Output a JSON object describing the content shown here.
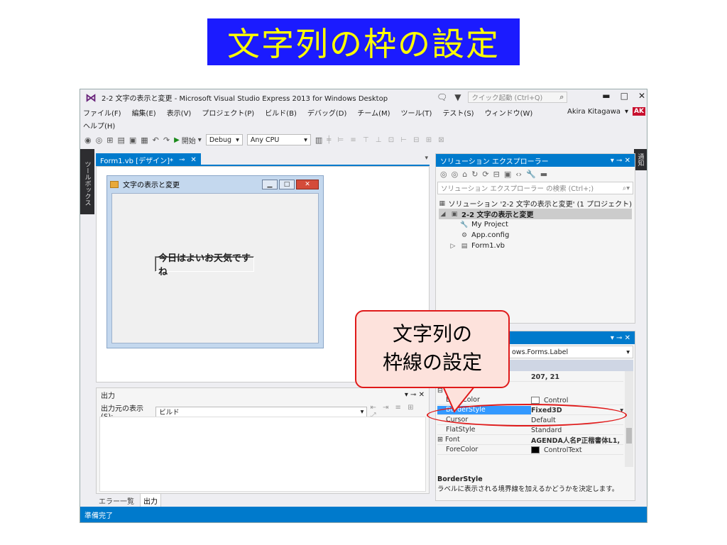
{
  "slide_title": "文字列の枠の設定",
  "window": {
    "title": "2-2 文字の表示と変更 - Microsoft Visual Studio Express 2013 for Windows Desktop",
    "quick_launch_placeholder": "クイック起動 (Ctrl+Q)",
    "user_name": "Akira Kitagawa",
    "avatar_initials": "AK"
  },
  "menu": {
    "row1": [
      "ファイル(F)",
      "編集(E)",
      "表示(V)",
      "プロジェクト(P)",
      "ビルド(B)",
      "デバッグ(D)",
      "チーム(M)",
      "ツール(T)",
      "テスト(S)",
      "ウィンドウ(W)"
    ],
    "row2": [
      "ヘルプ(H)"
    ]
  },
  "toolbar": {
    "start_label": "開始",
    "config": "Debug",
    "platform": "Any CPU"
  },
  "side_tabs": {
    "left": "ツールボックス",
    "right": "通知"
  },
  "designer": {
    "tab_label": "Form1.vb [デザイン]*",
    "form_title": "文字の表示と変更",
    "label_text": "今日はよいお天気ですね"
  },
  "output": {
    "title": "出力",
    "source_label": "出力元の表示(S):",
    "source_value": "ビルド"
  },
  "bottom_tabs": [
    "エラー一覧",
    "出力"
  ],
  "status_text": "準備完了",
  "solution_explorer": {
    "title": "ソリューション エクスプローラー",
    "search_placeholder": "ソリューション エクスプローラー の検索 (Ctrl+;)",
    "tree": [
      "ソリューション '2-2 文字の表示と変更' (1 プロジェクト)",
      "2-2 文字の表示と変更",
      "My Project",
      "App.config",
      "Form1.vb"
    ]
  },
  "properties": {
    "type_suffix": "ows.Forms.Label",
    "size_value": "207, 21",
    "category": "表",
    "rows": [
      {
        "name": "BackColor",
        "value": "Control"
      },
      {
        "name": "BorderStyle",
        "value": "Fixed3D"
      },
      {
        "name": "Cursor",
        "value": "Default"
      },
      {
        "name": "FlatStyle",
        "value": "Standard"
      },
      {
        "name": "Font",
        "value": "AGENDA人名P正楷書体L1,"
      },
      {
        "name": "ForeColor",
        "value": "ControlText"
      }
    ],
    "desc_title": "BorderStyle",
    "desc_text": "ラベルに表示される境界線を加えるかどうかを決定します。"
  },
  "callout": {
    "line1": "文字列の",
    "line2": "枠線の設定"
  }
}
